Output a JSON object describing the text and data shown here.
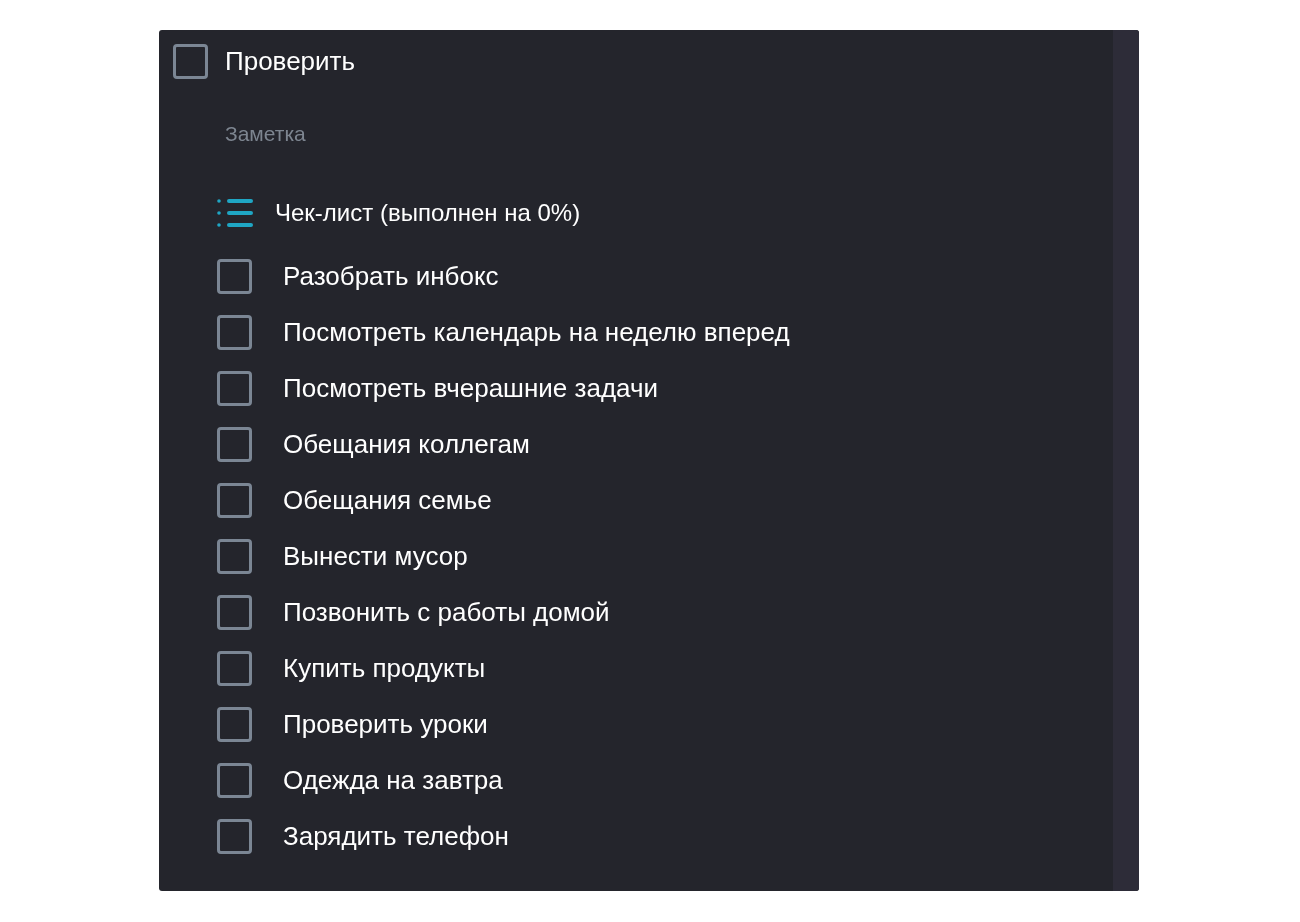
{
  "task": {
    "title": "Проверить",
    "checked": false
  },
  "note": {
    "placeholder": "Заметка"
  },
  "checklist": {
    "title": "Чек-лист (выполнен на 0%)",
    "items": [
      {
        "label": "Разобрать инбокс",
        "checked": false
      },
      {
        "label": "Посмотреть календарь на неделю вперед",
        "checked": false
      },
      {
        "label": "Посмотреть вчерашние задачи",
        "checked": false
      },
      {
        "label": "Обещания коллегам",
        "checked": false
      },
      {
        "label": "Обещания семье",
        "checked": false
      },
      {
        "label": "Вынести мусор",
        "checked": false
      },
      {
        "label": "Позвонить с работы домой",
        "checked": false
      },
      {
        "label": "Купить продукты",
        "checked": false
      },
      {
        "label": "Проверить уроки",
        "checked": false
      },
      {
        "label": "Одежда на завтра",
        "checked": false
      },
      {
        "label": "Зарядить телефон",
        "checked": false
      }
    ]
  }
}
